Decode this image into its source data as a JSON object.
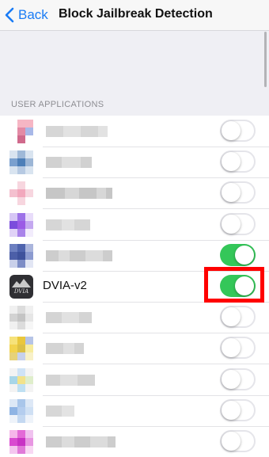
{
  "nav": {
    "back_label": "Back",
    "title": "Block Jailbreak Detection"
  },
  "section": {
    "header": "USER APPLICATIONS"
  },
  "colors": {
    "accent": "#1a7cf5",
    "toggle_on": "#34c759",
    "highlight": "#ff0000"
  },
  "apps": [
    {
      "name": "",
      "blurred": true,
      "enabled": false,
      "icon": [
        "#ffffff",
        "#f6b6c4",
        "#f6b6c4",
        "#ffffff",
        "#e38aa5",
        "#a8b8e8",
        "#ffffff",
        "#d06a8c",
        "#ffffff"
      ],
      "label_widths": [
        22,
        22,
        22,
        12
      ],
      "label_color": "#cfcfcf"
    },
    {
      "name": "",
      "blurred": true,
      "enabled": false,
      "icon": [
        "#d9e4f0",
        "#9fb9d8",
        "#d9e4f0",
        "#7aa0cf",
        "#4d7fb8",
        "#9cb6d6",
        "#d9e4f0",
        "#b6c9e2",
        "#d9e4f0"
      ],
      "label_widths": [
        20,
        24,
        14
      ],
      "label_color": "#c9c9c9"
    },
    {
      "name": "",
      "blurred": true,
      "enabled": false,
      "icon": [
        "#ffffff",
        "#f7d6df",
        "#ffffff",
        "#f4c0cf",
        "#f2a8bd",
        "#f7d6df",
        "#ffffff",
        "#f7d6df",
        "#ffffff"
      ],
      "label_widths": [
        24,
        18,
        22,
        12,
        8
      ],
      "label_color": "#bcbcbc"
    },
    {
      "name": "",
      "blurred": true,
      "enabled": false,
      "icon": [
        "#d6c6f5",
        "#9d72e8",
        "#e8dcfa",
        "#7b4ddc",
        "#9b5ae6",
        "#c4a8f0",
        "#e0d2f7",
        "#a983ea",
        "#f2ecfc"
      ],
      "label_widths": [
        20,
        16,
        20
      ],
      "label_color": "#cfcfcf"
    },
    {
      "name": "",
      "blurred": true,
      "enabled": true,
      "icon": [
        "#6c7fc0",
        "#4e63ad",
        "#aab5dc",
        "#4c5fa8",
        "#3e529c",
        "#8c9bd0",
        "#c9d0ea",
        "#7d8dc6",
        "#e2e6f4"
      ],
      "label_widths": [
        16,
        14,
        20,
        22,
        12
      ],
      "label_color": "#c4c4c4"
    },
    {
      "name": "DVIA-v2",
      "blurred": false,
      "enabled": true,
      "icon_name": "dvia-app-icon",
      "icon_text": "DVIA"
    },
    {
      "name": "",
      "blurred": true,
      "enabled": false,
      "icon": [
        "#f0f0f0",
        "#dcdcdc",
        "#f0f0f0",
        "#d2d2d2",
        "#c4c4c4",
        "#e6e6e6",
        "#f0f0f0",
        "#dcdcdc",
        "#f6f6f6"
      ],
      "label_widths": [
        20,
        22,
        16
      ],
      "label_color": "#cdcdcd"
    },
    {
      "name": "",
      "blurred": true,
      "enabled": false,
      "icon": [
        "#f6e27a",
        "#e9c73c",
        "#b6c4e6",
        "#f2d34e",
        "#dbc046",
        "#f7ec9e",
        "#e6d27a",
        "#c7d1ec",
        "#f8f1c8"
      ],
      "label_widths": [
        22,
        14,
        12
      ],
      "label_color": "#cccccc"
    },
    {
      "name": "",
      "blurred": true,
      "enabled": false,
      "icon": [
        "#f3f3f3",
        "#cfe3f6",
        "#f3f3f3",
        "#a8d6e8",
        "#f2e28a",
        "#dfeecb",
        "#f3f3f3",
        "#bfe0f2",
        "#f3f3f3"
      ],
      "label_widths": [
        18,
        22,
        22
      ],
      "label_color": "#cdcdcd"
    },
    {
      "name": "",
      "blurred": true,
      "enabled": false,
      "icon": [
        "#dde8f6",
        "#a9c6ea",
        "#dde8f6",
        "#8fb4e4",
        "#b4cdee",
        "#cfe0f4",
        "#eef3fa",
        "#c4d8f1",
        "#eef3fa"
      ],
      "label_widths": [
        20,
        16
      ],
      "label_color": "#d0d0d0"
    },
    {
      "name": "",
      "blurred": true,
      "enabled": false,
      "icon": [
        "#f6b6ea",
        "#e36ad7",
        "#f0c2ef",
        "#d94ad0",
        "#c832c4",
        "#e896e2",
        "#f4c6ef",
        "#e07ad8",
        "#f8d8f3"
      ],
      "label_widths": [
        20,
        16,
        20,
        22,
        10
      ],
      "label_color": "#c4c4c4"
    }
  ]
}
